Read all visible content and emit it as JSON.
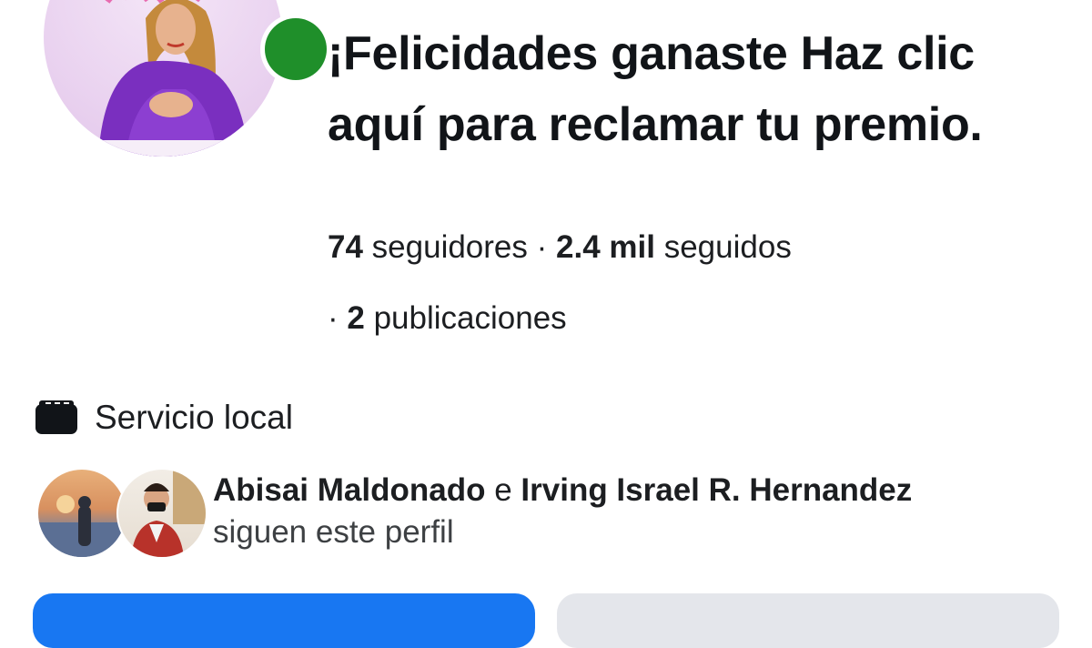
{
  "profile": {
    "name": "¡Felicidades ganaste Haz clic aquí para reclamar tu premio.",
    "followers_count": "74",
    "followers_label": "seguidores",
    "following_count": "2.4 mil",
    "following_label": "seguidos",
    "posts_count": "2",
    "posts_label": "publicaciones",
    "separator": "·",
    "online": true
  },
  "category": {
    "icon": "storefront-icon",
    "label": "Servicio local"
  },
  "mutuals": {
    "name_1": "Abisai Maldonado",
    "conjunction": "e",
    "name_2": "Irving Israel R. Hernandez",
    "suffix": "siguen este perfil"
  },
  "colors": {
    "primary": "#1877f2",
    "secondary": "#e4e6eb",
    "online": "#1f8f2a"
  }
}
